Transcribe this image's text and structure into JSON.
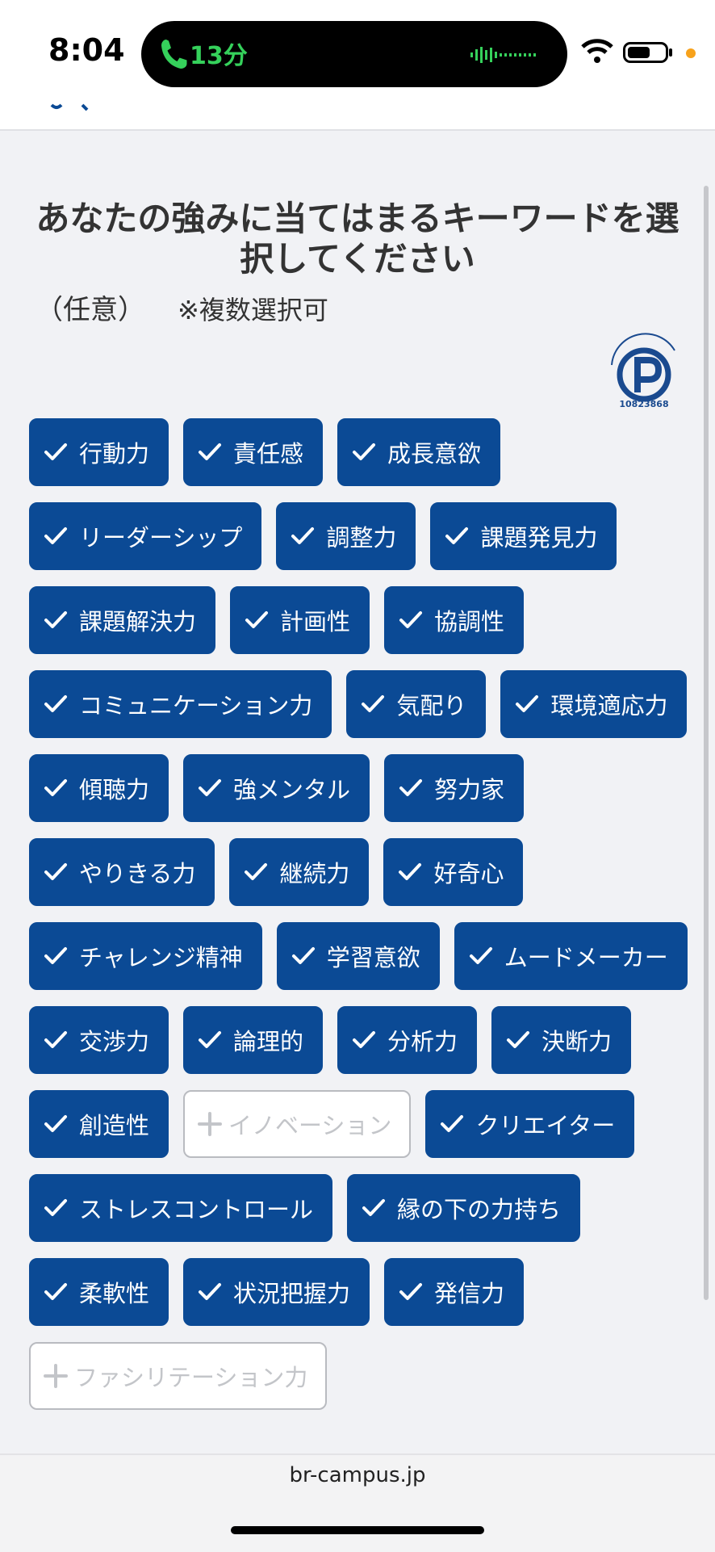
{
  "status": {
    "time": "8:04",
    "call_duration": "13分",
    "accent_call_color": "#35d15b"
  },
  "page": {
    "title": "あなたの強みに当てはまるキーワードを選択してください",
    "optional_label": "（任意）",
    "multi_note": "※複数選択可",
    "privacy_code": "10823868"
  },
  "colors": {
    "chip_selected": "#0b4a95",
    "chip_unselected_border": "#b9bbc0",
    "background": "#f1f2f5"
  },
  "keywords": [
    {
      "label": "行動力",
      "selected": true
    },
    {
      "label": "責任感",
      "selected": true
    },
    {
      "label": "成長意欲",
      "selected": true
    },
    {
      "label": "リーダーシップ",
      "selected": true
    },
    {
      "label": "調整力",
      "selected": true
    },
    {
      "label": "課題発見力",
      "selected": true
    },
    {
      "label": "課題解決力",
      "selected": true
    },
    {
      "label": "計画性",
      "selected": true
    },
    {
      "label": "協調性",
      "selected": true
    },
    {
      "label": "コミュニケーション力",
      "selected": true
    },
    {
      "label": "気配り",
      "selected": true
    },
    {
      "label": "環境適応力",
      "selected": true
    },
    {
      "label": "傾聴力",
      "selected": true
    },
    {
      "label": "強メンタル",
      "selected": true
    },
    {
      "label": "努力家",
      "selected": true
    },
    {
      "label": "やりきる力",
      "selected": true
    },
    {
      "label": "継続力",
      "selected": true
    },
    {
      "label": "好奇心",
      "selected": true
    },
    {
      "label": "チャレンジ精神",
      "selected": true
    },
    {
      "label": "学習意欲",
      "selected": true
    },
    {
      "label": "ムードメーカー",
      "selected": true
    },
    {
      "label": "交渉力",
      "selected": true
    },
    {
      "label": "論理的",
      "selected": true
    },
    {
      "label": "分析力",
      "selected": true
    },
    {
      "label": "決断力",
      "selected": true
    },
    {
      "label": "創造性",
      "selected": true
    },
    {
      "label": "イノベーション",
      "selected": false
    },
    {
      "label": "クリエイター",
      "selected": true
    },
    {
      "label": "ストレスコントロール",
      "selected": true
    },
    {
      "label": "縁の下の力持ち",
      "selected": true
    },
    {
      "label": "柔軟性",
      "selected": true
    },
    {
      "label": "状況把握力",
      "selected": true
    },
    {
      "label": "発信力",
      "selected": true
    },
    {
      "label": "ファシリテーション力",
      "selected": false
    }
  ],
  "browser": {
    "url": "br-campus.jp"
  }
}
